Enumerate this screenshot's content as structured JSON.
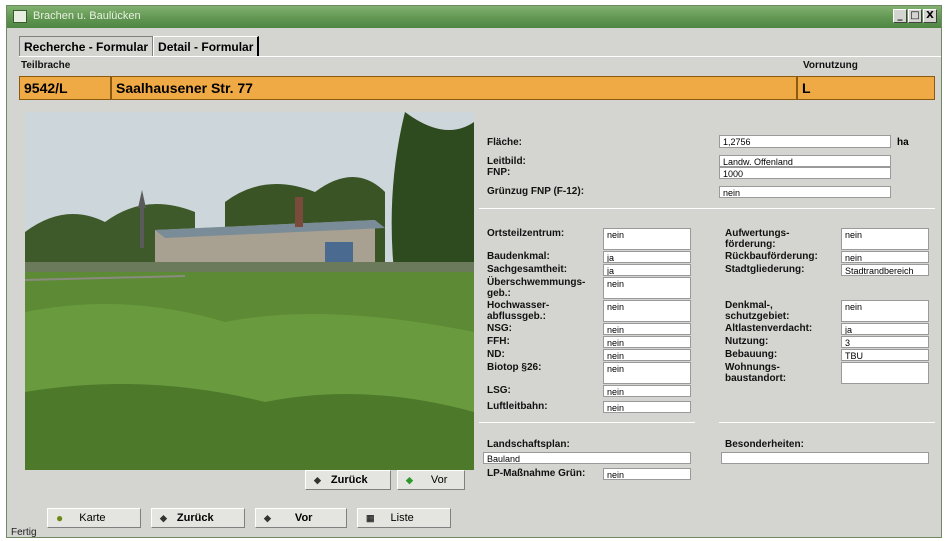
{
  "window": {
    "title": "Brachen u. Baulücken",
    "btn_min": "_",
    "btn_max": "□",
    "btn_close": "X"
  },
  "tabs": [
    {
      "label": "Recherche - Formular"
    },
    {
      "label": "Detail - Formular"
    }
  ],
  "header": {
    "teilbrache_label": "Teilbrache",
    "vornutzung_label": "Vornutzung",
    "id": "9542/L",
    "address": "Saalhausener Str. 77",
    "vornutzung": "L"
  },
  "fields_top": [
    {
      "label": "Fläche:",
      "value": "1,2756",
      "unit": "ha"
    },
    {
      "label": "Leitbild:",
      "value": "Landw. Offenland"
    },
    {
      "label": "FNP:",
      "value": "1000"
    },
    {
      "label": "Grünzug FNP (F-12):",
      "value": "nein"
    }
  ],
  "fields_left": [
    {
      "label": "Ortsteilzentrum:",
      "value": "nein"
    },
    {
      "label": "Baudenkmal:",
      "value": "ja"
    },
    {
      "label": "Sachgesamtheit:",
      "value": "ja"
    },
    {
      "label": "Überschwemmungs-\ngeb.:",
      "value": "nein"
    },
    {
      "label": "Hochwasser-\nabflussgeb.:",
      "value": "nein"
    },
    {
      "label": "NSG:",
      "value": "nein"
    },
    {
      "label": "FFH:",
      "value": "nein"
    },
    {
      "label": "ND:",
      "value": "nein"
    },
    {
      "label": "Biotop §26:",
      "value": "nein"
    },
    {
      "label": "LSG:",
      "value": "nein"
    },
    {
      "label": "Luftleitbahn:",
      "value": "nein"
    }
  ],
  "fields_right": [
    {
      "label": "Aufwertungs-\nförderung:",
      "value": "nein"
    },
    {
      "label": "Rückbauförderung:",
      "value": "nein"
    },
    {
      "label": "Stadtgliederung:",
      "value": "Stadtrandbereich"
    },
    {
      "label": "Denkmal-,\nschutzgebiet:",
      "value": "nein"
    },
    {
      "label": "Altlastenverdacht:",
      "value": "ja"
    },
    {
      "label": "Nutzung:",
      "value": "3"
    },
    {
      "label": "Bebauung:",
      "value": "TBU"
    },
    {
      "label": "Wohnungs-\nbaustandort:",
      "value": ""
    }
  ],
  "landschaftsplan": {
    "label": "Landschaftsplan:",
    "value": "Bauland"
  },
  "besonderheiten": {
    "label": "Besonderheiten:",
    "value": ""
  },
  "lp_massnahme": {
    "label": "LP-Maßnahme Grün:",
    "value": "nein"
  },
  "photo_nav": {
    "back": "Zurück",
    "forward": "Vor"
  },
  "bottom_nav": {
    "map": "Karte",
    "back": "Zurück",
    "forward": "Vor",
    "list": "Liste"
  },
  "status": "Fertig",
  "colors": {
    "accent": "#f0aa45",
    "titlebar": "#5e9550",
    "window": "#d4d4d0"
  }
}
